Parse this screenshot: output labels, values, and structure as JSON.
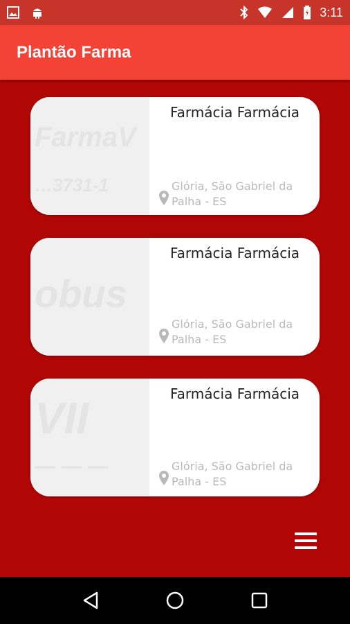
{
  "status_bar": {
    "time": "3:11",
    "left_icons": [
      "image-icon",
      "android-icon"
    ],
    "right_icons": [
      "bluetooth-icon",
      "wifi-icon",
      "signal-icon",
      "battery-icon"
    ]
  },
  "app_bar": {
    "title": "Plantão Farma",
    "color": "#f44336"
  },
  "background_color": "#b00606",
  "pharmacies": [
    {
      "name": "Farmácia Farmácia",
      "address": "Glória, São Gabriel da Palha - ES"
    },
    {
      "name": "Farmácia Farmácia",
      "address": "Glória, São Gabriel da Palha - ES"
    },
    {
      "name": "Farmácia Farmácia",
      "address": "Glória, São Gabriel da Palha - ES"
    }
  ],
  "menu_icon": "hamburger-menu-icon",
  "nav_bar": {
    "buttons": [
      "back-icon",
      "home-icon",
      "recents-icon"
    ]
  }
}
